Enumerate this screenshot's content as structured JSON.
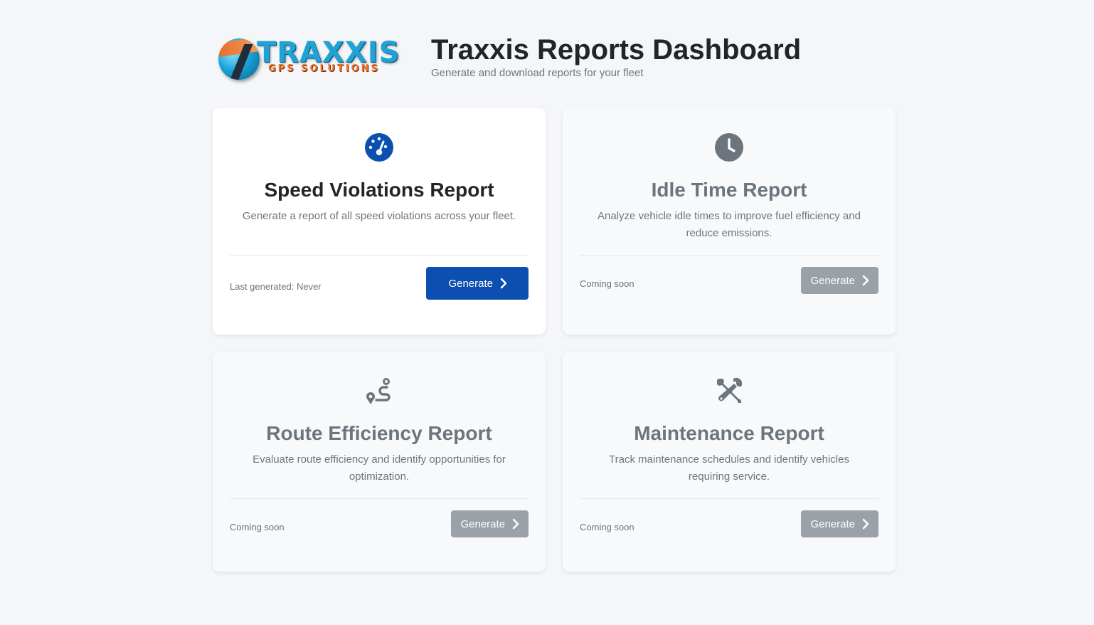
{
  "header": {
    "logo": {
      "brand": "TRAXXIS",
      "tagline": "GPS SOLUTIONS"
    },
    "title": "Traxxis Reports Dashboard",
    "subtitle": "Generate and download reports for your fleet"
  },
  "colors": {
    "primary": "#0b4fb0",
    "muted_button": "#9aa1a8",
    "icon_active": "#0b4fb0",
    "icon_disabled": "#6c757d",
    "background": "#f4f6f9"
  },
  "reports": [
    {
      "icon": "speedometer-icon",
      "title": "Speed Violations Report",
      "description": "Generate a report of all speed violations across your fleet.",
      "status": "Last generated: Never",
      "button_label": "Generate",
      "enabled": true
    },
    {
      "icon": "clock-icon",
      "title": "Idle Time Report",
      "description": "Analyze vehicle idle times to improve fuel efficiency and reduce emissions.",
      "status": "Coming soon",
      "button_label": "Generate",
      "enabled": false
    },
    {
      "icon": "route-icon",
      "title": "Route Efficiency Report",
      "description": "Evaluate route efficiency and identify opportunities for optimization.",
      "status": "Coming soon",
      "button_label": "Generate",
      "enabled": false
    },
    {
      "icon": "tools-icon",
      "title": "Maintenance Report",
      "description": "Track maintenance schedules and identify vehicles requiring service.",
      "status": "Coming soon",
      "button_label": "Generate",
      "enabled": false
    }
  ]
}
